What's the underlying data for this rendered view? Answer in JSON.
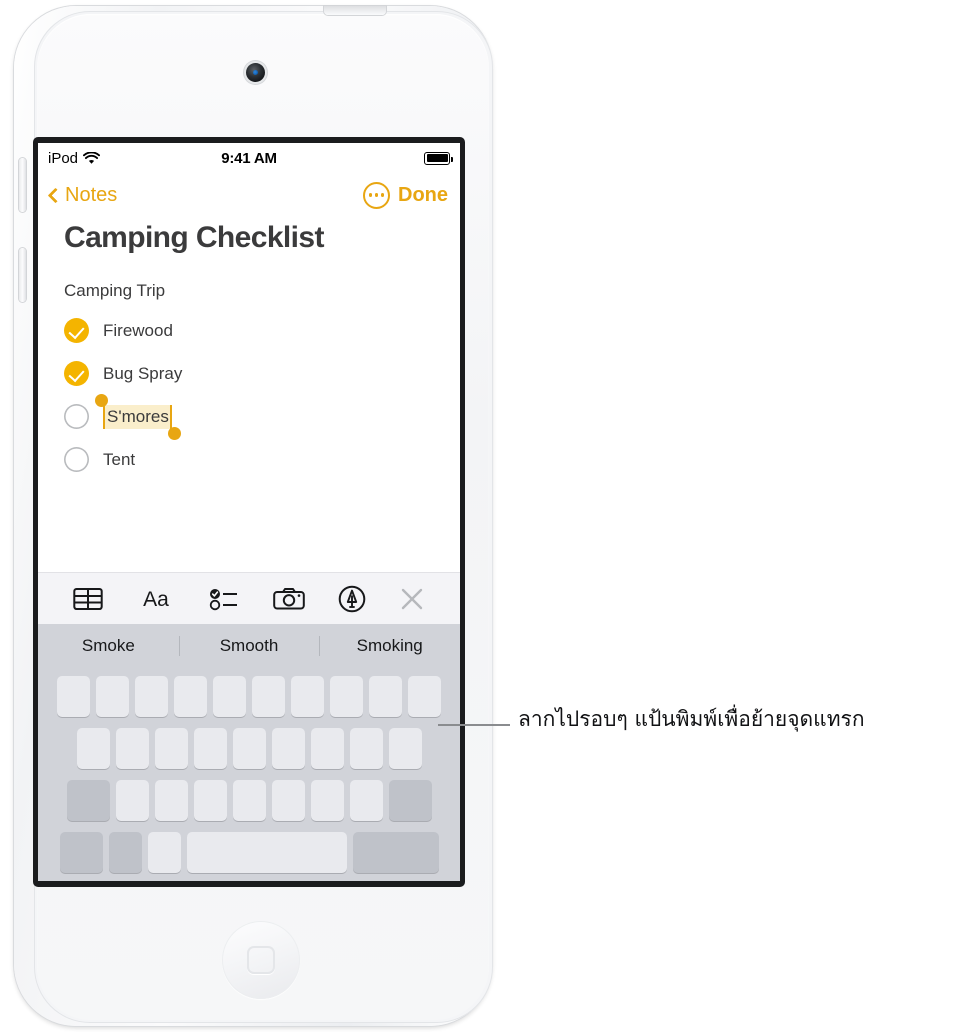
{
  "device": {
    "name": "iPod touch",
    "camera_icon": "front-camera",
    "home_button_icon": "home-square-icon"
  },
  "status_bar": {
    "carrier": "iPod",
    "wifi_icon": "wifi-icon",
    "time": "9:41 AM",
    "battery_icon": "battery-full-icon"
  },
  "nav_bar": {
    "back_icon": "chevron-left-icon",
    "back_label": "Notes",
    "more_icon": "more-circle-icon",
    "done_label": "Done"
  },
  "note": {
    "title": "Camping Checklist",
    "subtitle": "Camping Trip",
    "items": [
      {
        "label": "Firewood",
        "checked": true
      },
      {
        "label": "Bug Spray",
        "checked": true
      },
      {
        "label": "S'mores",
        "checked": false,
        "selected": true
      },
      {
        "label": "Tent",
        "checked": false,
        "clipped": true
      }
    ],
    "selection": {
      "text": "S'mores",
      "highlight_color": "#faeecb",
      "handle_color": "#E8A612"
    }
  },
  "toolbar": {
    "items": [
      {
        "icon": "table-icon",
        "label": "Table"
      },
      {
        "icon": "text-format-icon",
        "label": "Aa"
      },
      {
        "icon": "checklist-icon",
        "label": "Checklist"
      },
      {
        "icon": "camera-icon",
        "label": "Camera"
      },
      {
        "icon": "markup-pen-icon",
        "label": "Markup"
      },
      {
        "icon": "close-icon",
        "label": "Close"
      }
    ]
  },
  "keyboard": {
    "suggestions": [
      "Smoke",
      "Smooth",
      "Smoking"
    ],
    "rows": [
      {
        "keys": 10,
        "type": "letter"
      },
      {
        "keys": 9,
        "type": "letter"
      },
      {
        "keys": 9,
        "type": "letter-with-shift-delete"
      },
      {
        "keys": 5,
        "type": "bottom"
      }
    ],
    "blank_keys": true
  },
  "callout": {
    "text": "ลากไปรอบๆ แป้นพิมพ์เพื่อย้ายจุดแทรก"
  },
  "colors": {
    "accent": "#E8A612",
    "checkbox_filled": "#F4B400",
    "keyboard_bg": "#d1d3d9",
    "key_light": "#e9eaee",
    "key_dark": "#bfc2c9",
    "toolbar_bg": "#f4f4f7",
    "text": "#3b3b3c"
  }
}
